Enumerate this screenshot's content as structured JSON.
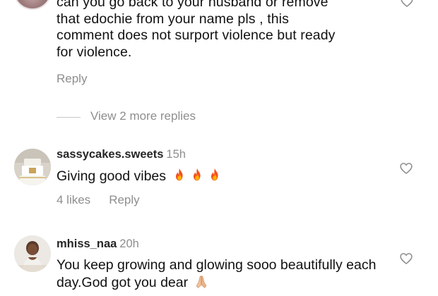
{
  "comments": [
    {
      "text": "can you go back to your husband or remove\nthat edochie from your name pls , this\ncomment does not surport violence but ready\nfor violence.",
      "reply_label": "Reply",
      "view_replies": "View 2 more replies"
    },
    {
      "username": "sassycakes.sweets",
      "time": "15h",
      "text": "Giving good vibes",
      "likes": "4 likes",
      "reply_label": "Reply"
    },
    {
      "username": "mhiss_naa",
      "time": "20h",
      "text": "You keep growing and glowing sooo beautifully each day.God got you dear"
    }
  ],
  "icons": {
    "like": "heart-outline-icon",
    "emoji_fire": "fire-emoji",
    "emoji_pray": "folded-hands-emoji"
  },
  "colors": {
    "text": "#111111",
    "secondary": "#8e8e8e",
    "divider": "#c7c7c7",
    "fire": "#f4511e"
  }
}
